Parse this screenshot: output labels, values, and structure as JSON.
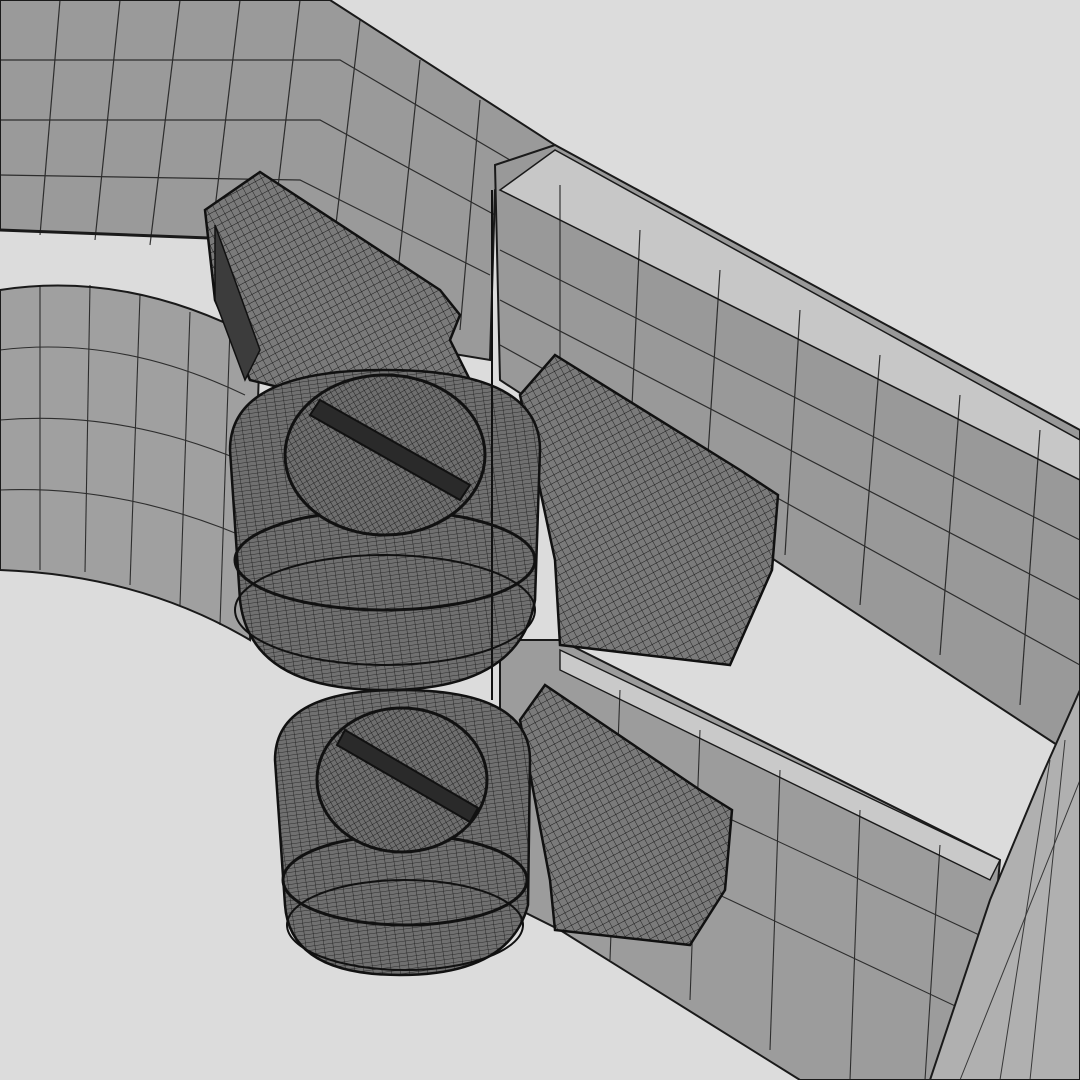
{
  "scene": {
    "background_color": "#dcdcdc",
    "surface_color": "#8e8e8e",
    "surface_light": "#b9b9b9",
    "wire_color": "#1a1a1a",
    "objects": [
      "glasses-frame-front",
      "temple-arm",
      "upper-hinge-knuckle",
      "lower-hinge-knuckle",
      "upper-screw-head",
      "lower-screw-head"
    ]
  }
}
